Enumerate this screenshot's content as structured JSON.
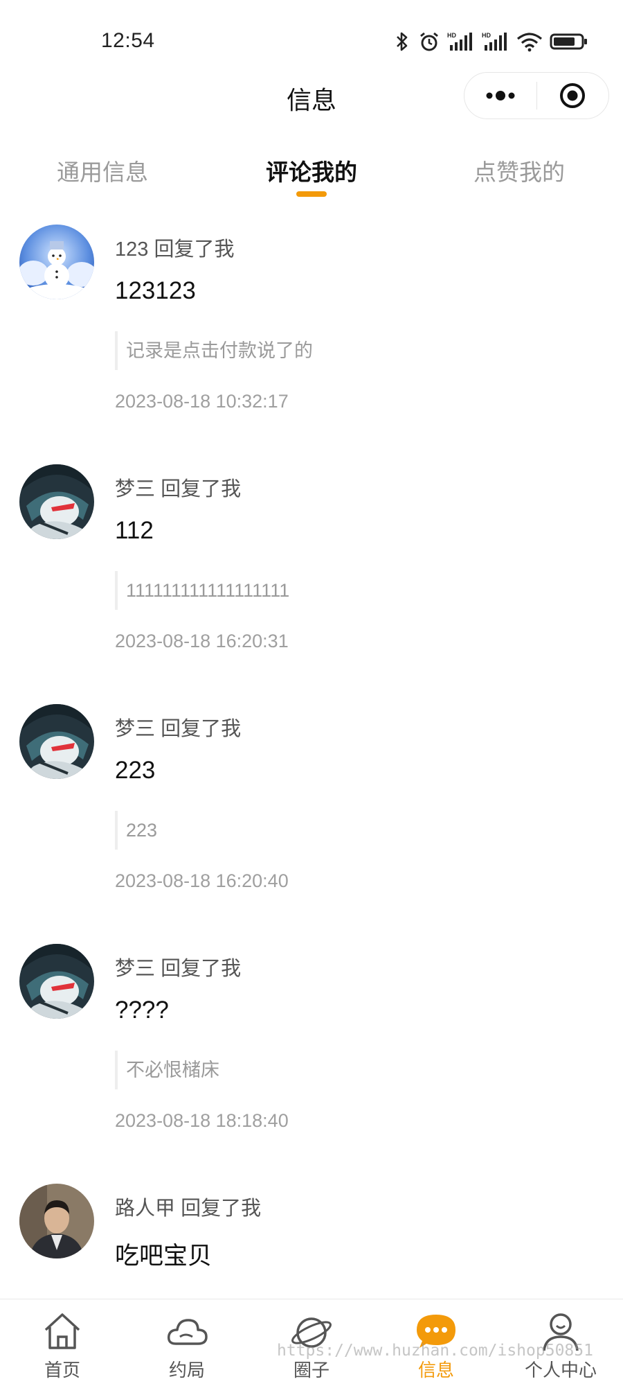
{
  "status_bar": {
    "time": "12:54"
  },
  "header": {
    "title": "信息"
  },
  "tabs": [
    {
      "label": "通用信息",
      "active": false
    },
    {
      "label": "评论我的",
      "active": true
    },
    {
      "label": "点赞我的",
      "active": false
    }
  ],
  "messages": [
    {
      "sender": "123",
      "action": "回复了我",
      "content": "123123",
      "quote": "记录是点击付款说了的",
      "time": "2023-08-18 10:32:17",
      "avatar": "snowman-avatar"
    },
    {
      "sender": "梦三",
      "action": "回复了我",
      "content": "112",
      "quote": "111111111111111111",
      "time": "2023-08-18 16:20:31",
      "avatar": "anime-avatar"
    },
    {
      "sender": "梦三",
      "action": "回复了我",
      "content": "223",
      "quote": "223",
      "time": "2023-08-18 16:20:40",
      "avatar": "anime-avatar"
    },
    {
      "sender": "梦三",
      "action": "回复了我",
      "content": "????",
      "quote": "不必恨槠床",
      "time": "2023-08-18 18:18:40",
      "avatar": "anime-avatar"
    },
    {
      "sender": "路人甲",
      "action": "回复了我",
      "content": "吃吧宝贝",
      "quote": "",
      "time": "",
      "avatar": "man-avatar"
    }
  ],
  "tabbar": [
    {
      "label": "首页",
      "icon": "home-icon",
      "active": false
    },
    {
      "label": "约局",
      "icon": "cloud-icon",
      "active": false
    },
    {
      "label": "圈子",
      "icon": "planet-icon",
      "active": false
    },
    {
      "label": "信息",
      "icon": "chat-icon",
      "active": true
    },
    {
      "label": "个人中心",
      "icon": "user-icon",
      "active": false
    }
  ],
  "watermark": "https://www.huzhan.com/ishop50851",
  "colors": {
    "accent": "#f39a0a",
    "text": "#111111",
    "muted": "#9a9a9a"
  }
}
